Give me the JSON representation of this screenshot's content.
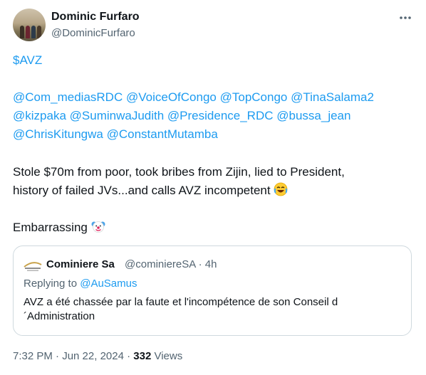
{
  "author": {
    "name": "Dominic Furfaro",
    "handle": "@DominicFurfaro"
  },
  "tweet": {
    "cashtag": "$AVZ",
    "mentions_line1": [
      "@Com_mediasRDC",
      "@VoiceOfCongo",
      "@TopCongo",
      "@TinaSalama2"
    ],
    "mentions_line2": [
      "@kizpaka",
      "@SuminwaJudith",
      "@Presidence_RDC",
      "@bussa_jean"
    ],
    "mentions_line3": [
      "@ChrisKitungwa",
      "@ConstantMutamba"
    ],
    "body_line1": "Stole $70m from poor, took bribes from Zijin, lied to President,",
    "body_line2": "history of failed JVs...and calls AVZ incompetent",
    "body_emoji": "laughing-crying-emoji",
    "closing": "Embarrassing",
    "closing_emoji": "clown-face-emoji"
  },
  "quote": {
    "name": "Cominiere Sa",
    "handle_time": "@cominiereSA · 4h",
    "reply_prefix": "Replying to",
    "reply_to": "@AuSamus",
    "text_line1": "AVZ a été chassée par la faute et l'incompétence de son Conseil d",
    "text_line2": "´Administration"
  },
  "meta": {
    "timestamp": "7:32 PM · Jun 22, 2024 · ",
    "views_count": "332",
    "views_label": " Views"
  },
  "colors": {
    "link": "#1d9bf0",
    "secondary": "#536471",
    "border": "#cfd9de"
  }
}
